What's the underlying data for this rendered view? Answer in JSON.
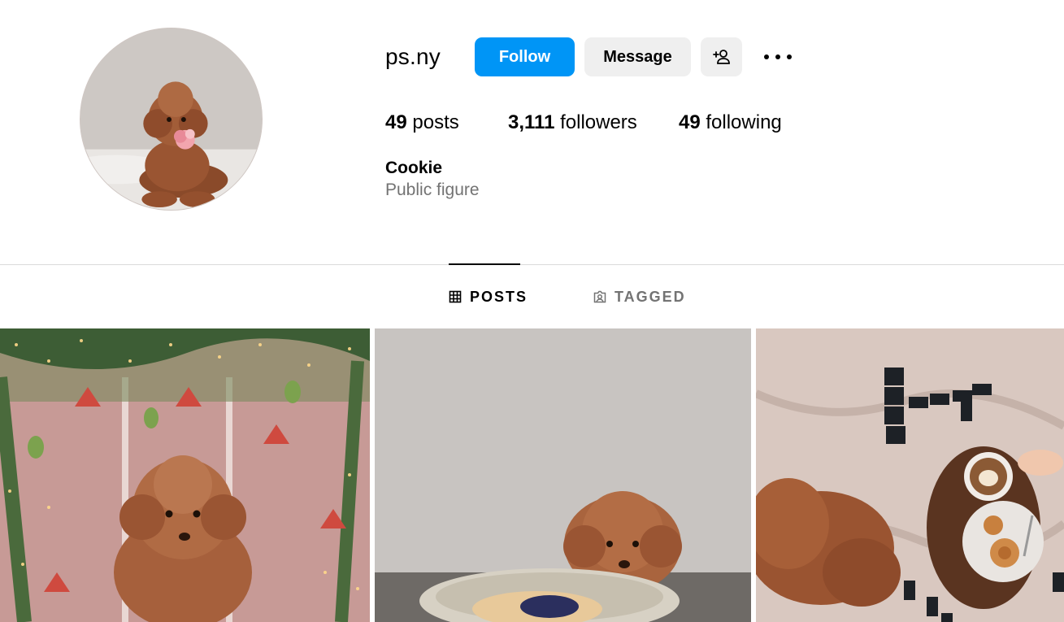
{
  "profile": {
    "username": "ps.ny",
    "full_name": "Cookie",
    "category": "Public figure",
    "avatar_alt": "profile-picture"
  },
  "actions": {
    "follow_label": "Follow",
    "message_label": "Message",
    "suggest_icon": "add-person-icon",
    "more_icon": "more-options-icon"
  },
  "stats": {
    "posts_count": "49",
    "posts_label": "posts",
    "followers_count": "3,111",
    "followers_label": "followers",
    "following_count": "49",
    "following_label": "following"
  },
  "tabs": [
    {
      "label": "POSTS",
      "icon": "grid-icon",
      "active": true
    },
    {
      "label": "TAGGED",
      "icon": "tagged-icon",
      "active": false
    }
  ],
  "posts": [
    {
      "name": "post-poodle-christmas-garland"
    },
    {
      "name": "post-poodle-blueberry-pancake"
    },
    {
      "name": "post-poodle-coffee-breakfast"
    }
  ],
  "colors": {
    "accent": "#0095f6",
    "secondary_button": "#efefef",
    "muted_text": "#737373",
    "divider": "#dbdbdb"
  }
}
